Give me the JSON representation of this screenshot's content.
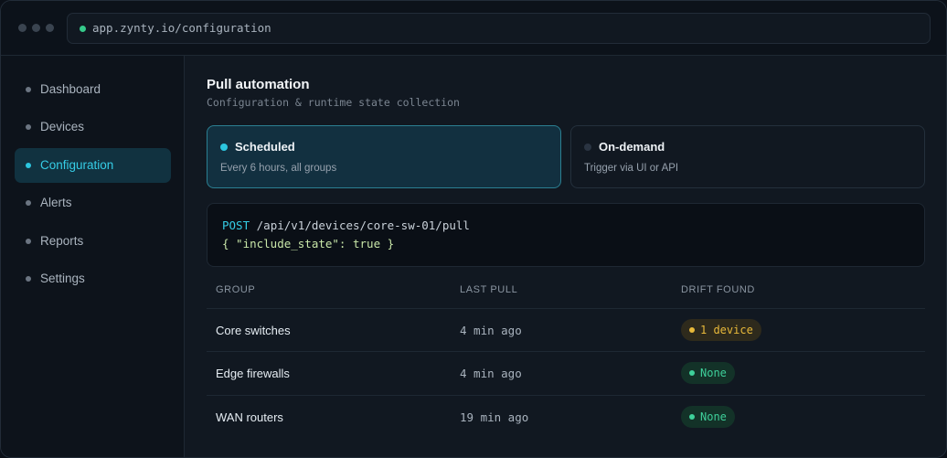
{
  "browser": {
    "url": "app.zynty.io/configuration"
  },
  "sidebar": {
    "items": [
      {
        "label": "Dashboard",
        "active": false
      },
      {
        "label": "Devices",
        "active": false
      },
      {
        "label": "Configuration",
        "active": true
      },
      {
        "label": "Alerts",
        "active": false
      },
      {
        "label": "Reports",
        "active": false
      },
      {
        "label": "Settings",
        "active": false
      }
    ]
  },
  "main": {
    "title": "Pull automation",
    "subtitle": "Configuration & runtime state collection",
    "modes": [
      {
        "name": "Scheduled",
        "desc": "Every 6 hours, all groups",
        "selected": true
      },
      {
        "name": "On-demand",
        "desc": "Trigger via UI or API",
        "selected": false
      }
    ],
    "code": {
      "method": "POST",
      "path": "/api/v1/devices/core-sw-01/pull",
      "body": "{ \"include_state\": true }"
    },
    "table": {
      "headers": [
        "GROUP",
        "LAST PULL",
        "DRIFT FOUND"
      ],
      "rows": [
        {
          "group": "Core switches",
          "last_pull": "4 min ago",
          "drift": "1 device",
          "status": "warn"
        },
        {
          "group": "Edge firewalls",
          "last_pull": "4 min ago",
          "drift": "None",
          "status": "ok"
        },
        {
          "group": "WAN routers",
          "last_pull": "19 min ago",
          "drift": "None",
          "status": "ok"
        }
      ]
    }
  },
  "colors": {
    "accent": "#2cc6df",
    "warning": "#e8b93a",
    "success": "#3ed09a",
    "background": "#111821"
  }
}
